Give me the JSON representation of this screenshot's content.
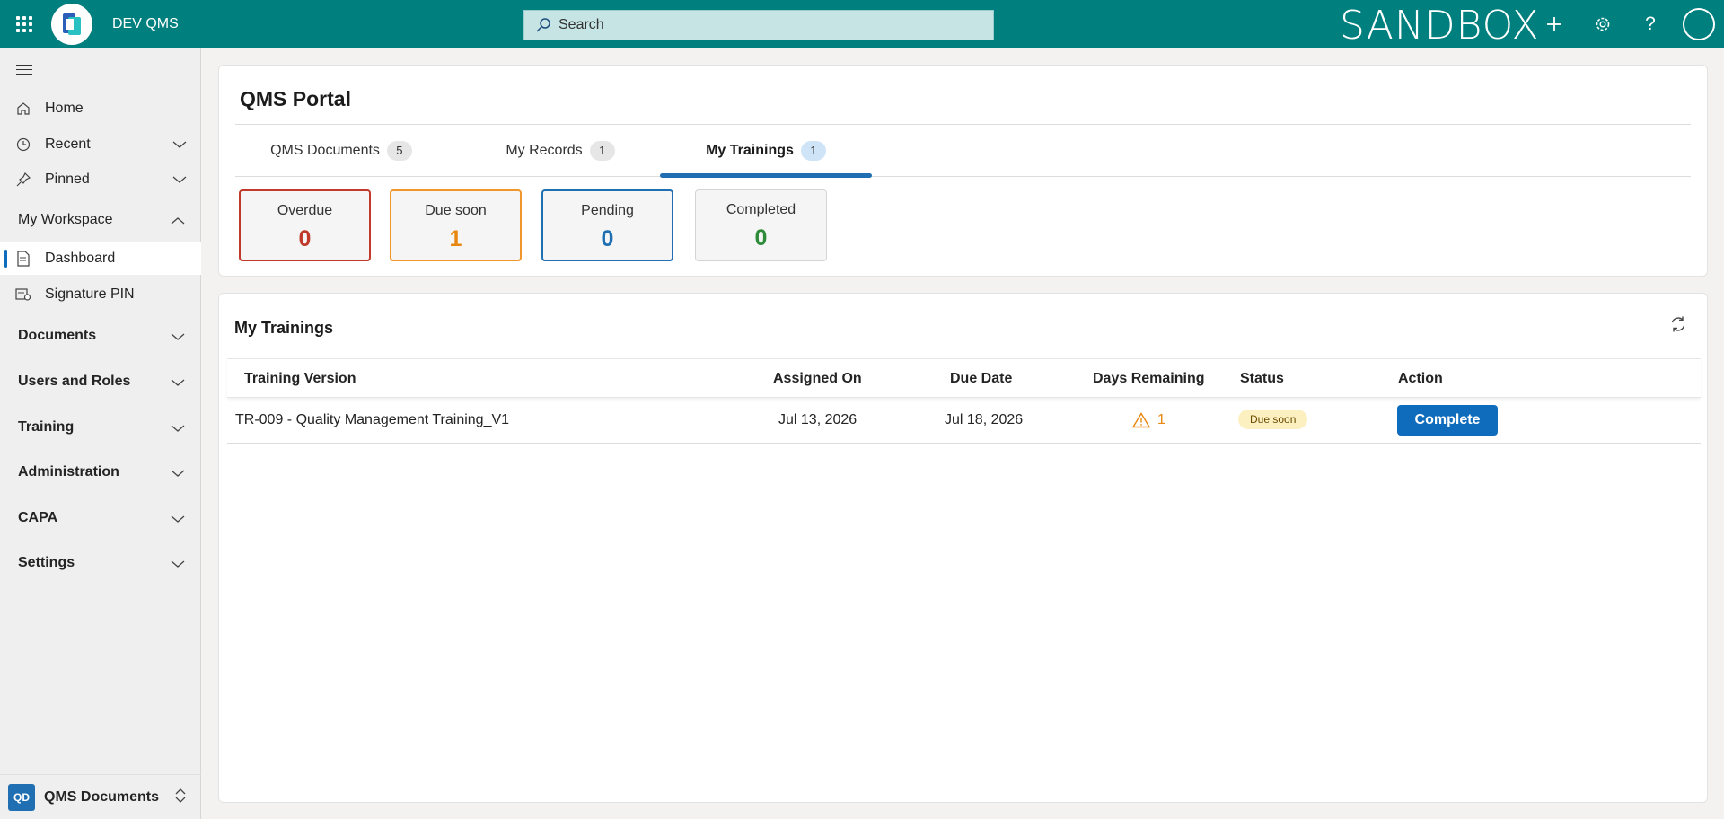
{
  "header": {
    "app_title": "DEV QMS",
    "search_placeholder": "Search",
    "environment_label": "SANDBOX"
  },
  "sidebar": {
    "items": [
      {
        "label": "Home",
        "icon": "home-icon"
      },
      {
        "label": "Recent",
        "icon": "clock-icon"
      },
      {
        "label": "Pinned",
        "icon": "pin-icon"
      }
    ],
    "workspace_group": "My Workspace",
    "workspace_items": [
      {
        "label": "Dashboard",
        "icon": "document-icon",
        "active": true
      },
      {
        "label": "Signature PIN",
        "icon": "signature-icon"
      }
    ],
    "groups": [
      "Documents",
      "Users and Roles",
      "Training",
      "Administration",
      "CAPA",
      "Settings"
    ],
    "footer": {
      "badge": "QD",
      "label": "QMS Documents"
    }
  },
  "portal": {
    "title": "QMS Portal",
    "tabs": [
      {
        "label": "QMS Documents",
        "count": "5"
      },
      {
        "label": "My Records",
        "count": "1"
      },
      {
        "label": "My Trainings",
        "count": "1",
        "active": true
      }
    ],
    "stats": [
      {
        "label": "Overdue",
        "value": "0",
        "color": "#c0392b",
        "border": "#c0392b"
      },
      {
        "label": "Due soon",
        "value": "1",
        "color": "#e8870f",
        "border": "#f0962a"
      },
      {
        "label": "Pending",
        "value": "0",
        "color": "#1f6fb2",
        "border": "#1f6fb2"
      },
      {
        "label": "Completed",
        "value": "0",
        "color": "#2e8b3a",
        "border": "#cccccc"
      }
    ]
  },
  "trainings": {
    "title": "My Trainings",
    "columns": [
      "Training Version",
      "Assigned On",
      "Due Date",
      "Days Remaining",
      "Status",
      "Action"
    ],
    "rows": [
      {
        "training_version": "TR-009 - Quality Management Training_V1",
        "assigned_on": "Jul 13, 2026",
        "due_date": "Jul 18, 2026",
        "days_remaining": "1",
        "status": "Due soon",
        "action": "Complete"
      }
    ]
  },
  "colors": {
    "topbar": "#007f7f",
    "accent": "#0f6cbd",
    "warning": "#e8870f"
  }
}
